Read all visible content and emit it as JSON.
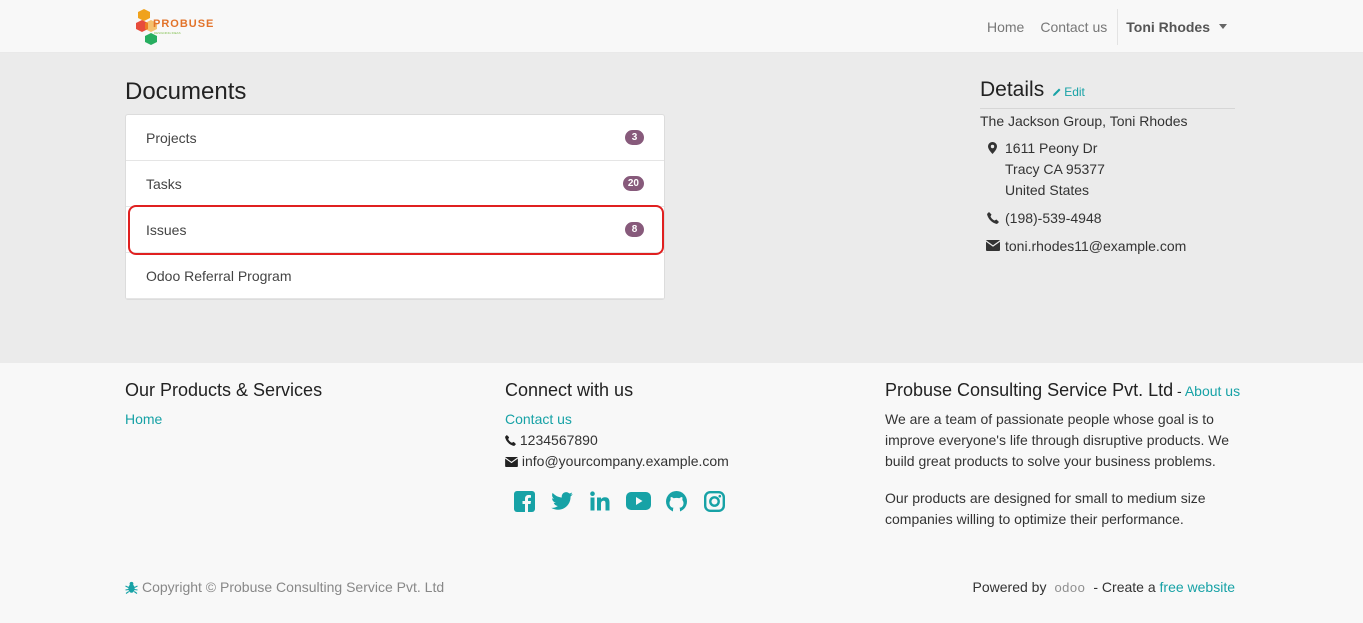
{
  "header": {
    "logo_text": "PROBUSE",
    "logo_subtext": "DESIGNING IDEAS",
    "nav": [
      {
        "label": "Home"
      },
      {
        "label": "Contact us"
      }
    ],
    "user_name": "Toni Rhodes"
  },
  "documents": {
    "title": "Documents",
    "items": [
      {
        "label": "Projects",
        "count": "3"
      },
      {
        "label": "Tasks",
        "count": "20"
      },
      {
        "label": "Issues",
        "count": "8"
      },
      {
        "label": "Odoo Referral Program",
        "count": ""
      }
    ]
  },
  "details": {
    "title": "Details",
    "edit_label": "Edit",
    "company": "The Jackson Group, Toni Rhodes",
    "address_line1": "1611 Peony Dr",
    "address_line2": "Tracy CA 95377",
    "address_line3": "United States",
    "phone": "(198)-539-4948",
    "email": "toni.rhodes11@example.com"
  },
  "footer": {
    "products_title": "Our Products & Services",
    "products_link": "Home",
    "connect_title": "Connect with us",
    "contact_link": "Contact us",
    "phone": "1234567890",
    "email": "info@yourcompany.example.com",
    "social": [
      "facebook-icon",
      "twitter-icon",
      "linkedin-icon",
      "youtube-icon",
      "github-icon",
      "instagram-icon"
    ],
    "company_title": "Probuse Consulting Service Pvt. Ltd",
    "company_sep": " - ",
    "about_link": "About us",
    "about_p1": "We are a team of passionate people whose goal is to improve everyone's life through disruptive products. We build great products to solve your business problems.",
    "about_p2": "Our products are designed for small to medium size companies willing to optimize their performance.",
    "copyright": "Copyright © Probuse Consulting Service Pvt. Ltd",
    "powered_by": "Powered by",
    "odoo": "odoo",
    "create_text": "- Create a",
    "free_website": "free website"
  },
  "colors": {
    "accent": "#17a2a6",
    "badge": "#875a7b",
    "highlight": "#e02020"
  }
}
